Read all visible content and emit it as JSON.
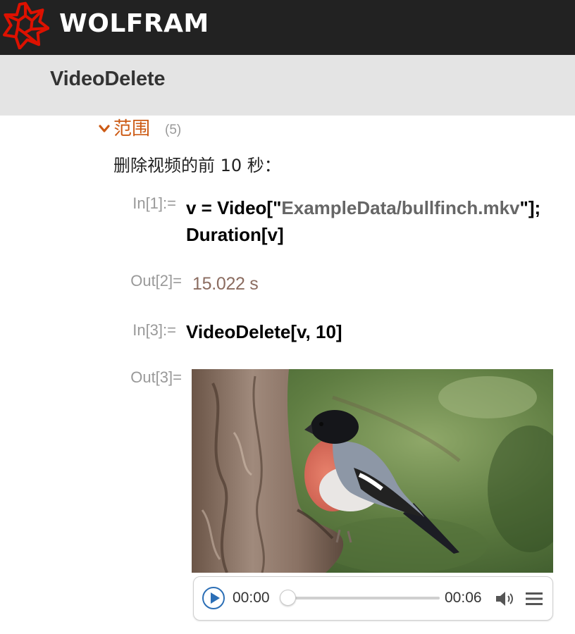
{
  "brand": {
    "name": "WOLFRAM",
    "logo_icon": "wolfram-spikey-icon",
    "logo_color": "#dd1100"
  },
  "page": {
    "title": "VideoDelete"
  },
  "section": {
    "label": "范围",
    "count": "(5)",
    "accent_color": "#cc5a14"
  },
  "example": {
    "description": "删除视频的前 10 秒：",
    "cells": [
      {
        "label": "In[1]:=",
        "line1_prefix": "v = Video[\"",
        "line1_string": "ExampleData/bullfinch.mkv",
        "line1_suffix": "\"];",
        "line2": "Duration[v]"
      },
      {
        "label": "Out[2]=",
        "value": "15.022 s"
      },
      {
        "label": "In[3]:=",
        "code": "VideoDelete[v, 10]"
      },
      {
        "label": "Out[3]="
      }
    ]
  },
  "player": {
    "current_time": "00:00",
    "total_time": "00:06",
    "progress": 0,
    "icons": [
      "play-icon",
      "volume-icon",
      "menu-icon"
    ]
  }
}
